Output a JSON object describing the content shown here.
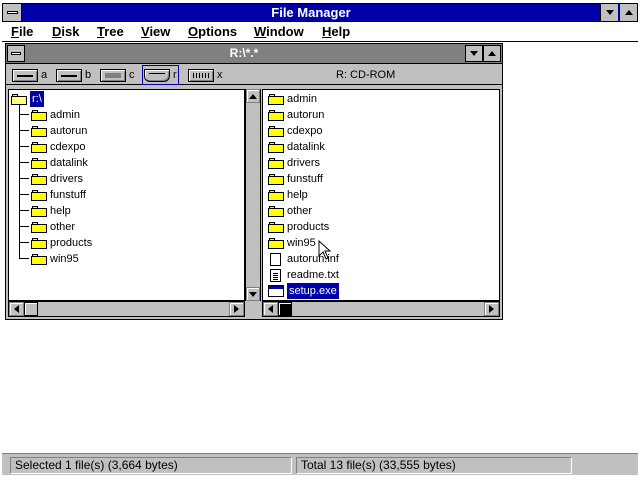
{
  "app": {
    "title": "File Manager"
  },
  "menu": [
    {
      "label_first": "F",
      "label_rest": "ile"
    },
    {
      "label_first": "D",
      "label_rest": "isk"
    },
    {
      "label_first": "T",
      "label_rest": "ree"
    },
    {
      "label_first": "V",
      "label_rest": "iew"
    },
    {
      "label_first": "O",
      "label_rest": "ptions"
    },
    {
      "label_first": "W",
      "label_rest": "indow"
    },
    {
      "label_first": "H",
      "label_rest": "elp"
    }
  ],
  "child_window": {
    "title": "R:\\*.*"
  },
  "drives": [
    {
      "letter": "a",
      "icon": "floppy-drive-icon"
    },
    {
      "letter": "b",
      "icon": "floppy-drive-icon"
    },
    {
      "letter": "c",
      "icon": "hard-drive-icon"
    },
    {
      "letter": "r",
      "icon": "cd-drive-icon",
      "selected": true
    },
    {
      "letter": "x",
      "icon": "network-drive-icon"
    }
  ],
  "volume_label": "R: CD-ROM",
  "tree": {
    "root": "r:\\",
    "folders": [
      "admin",
      "autorun",
      "cdexpo",
      "datalink",
      "drivers",
      "funstuff",
      "help",
      "other",
      "products",
      "win95"
    ]
  },
  "directory": {
    "items": [
      {
        "name": "admin",
        "type": "folder"
      },
      {
        "name": "autorun",
        "type": "folder"
      },
      {
        "name": "cdexpo",
        "type": "folder"
      },
      {
        "name": "datalink",
        "type": "folder"
      },
      {
        "name": "drivers",
        "type": "folder"
      },
      {
        "name": "funstuff",
        "type": "folder"
      },
      {
        "name": "help",
        "type": "folder"
      },
      {
        "name": "other",
        "type": "folder"
      },
      {
        "name": "products",
        "type": "folder"
      },
      {
        "name": "win95",
        "type": "folder"
      },
      {
        "name": "autorun.inf",
        "type": "file"
      },
      {
        "name": "readme.txt",
        "type": "text"
      },
      {
        "name": "setup.exe",
        "type": "exe",
        "selected": true
      }
    ]
  },
  "status": {
    "selected": "Selected 1 file(s) (3,664 bytes)",
    "total": "Total 13 file(s) (33,555 bytes)"
  },
  "colors": {
    "active_title": "#0000a8",
    "inactive_title": "#808080",
    "face": "#c0c0c0",
    "folder": "#ffff00",
    "selection": "#0000a8"
  }
}
